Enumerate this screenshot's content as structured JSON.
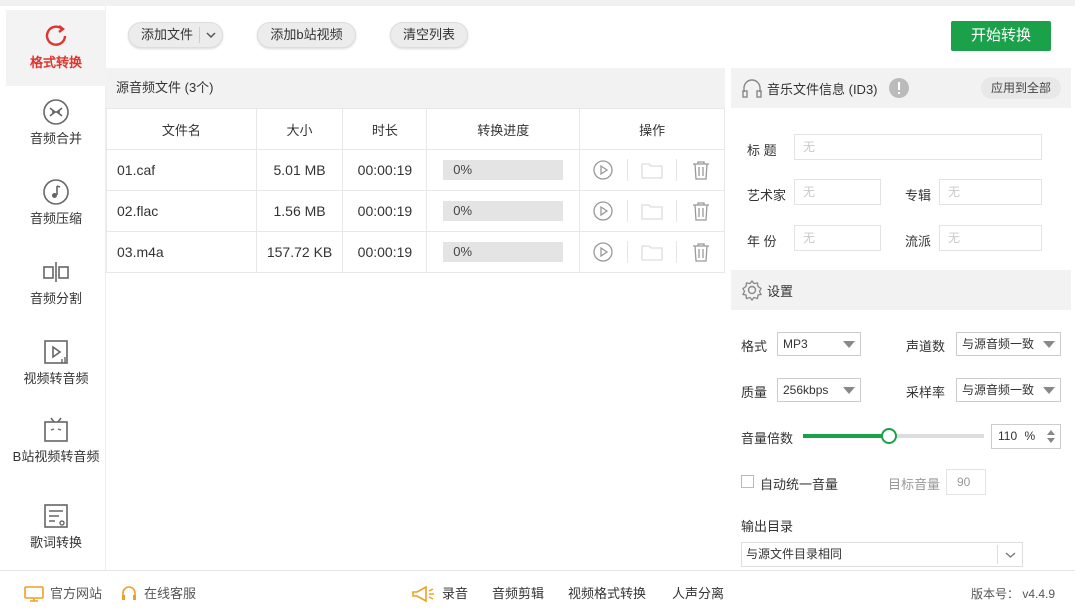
{
  "sidebar": {
    "items": [
      {
        "label": "格式转换",
        "icon": "refresh-icon"
      },
      {
        "label": "音频合并",
        "icon": "merge-icon"
      },
      {
        "label": "音频压缩",
        "icon": "music-note-icon"
      },
      {
        "label": "音频分割",
        "icon": "split-icon"
      },
      {
        "label": "视频转音频",
        "icon": "video-audio-icon"
      },
      {
        "label": "B站视频转音频",
        "icon": "bilibili-tv-icon"
      },
      {
        "label": "歌词转换",
        "icon": "lyrics-icon"
      }
    ]
  },
  "toolbar": {
    "add_file": "添加文件",
    "add_bilibili": "添加b站视频",
    "clear_list": "清空列表",
    "start": "开始转换"
  },
  "files": {
    "header": "源音频文件 (3个)",
    "columns": [
      "文件名",
      "大小",
      "时长",
      "转换进度",
      "操作"
    ],
    "rows": [
      {
        "name": "01.caf",
        "size": "5.01 MB",
        "duration": "00:00:19",
        "progress": "0%"
      },
      {
        "name": "02.flac",
        "size": "1.56 MB",
        "duration": "00:00:19",
        "progress": "0%"
      },
      {
        "name": "03.m4a",
        "size": "157.72 KB",
        "duration": "00:00:19",
        "progress": "0%"
      }
    ]
  },
  "id3": {
    "title": "音乐文件信息 (ID3)",
    "apply_all": "应用到全部",
    "fields": {
      "title_label": "标 题",
      "artist_label": "艺术家",
      "album_label": "专辑",
      "year_label": "年 份",
      "genre_label": "流派",
      "empty": "无"
    }
  },
  "settings": {
    "title": "设置",
    "format_label": "格式",
    "format_value": "MP3",
    "channels_label": "声道数",
    "channels_value": "与源音频一致",
    "quality_label": "质量",
    "quality_value": "256kbps",
    "samplerate_label": "采样率",
    "samplerate_value": "与源音频一致",
    "volume_label": "音量倍数",
    "volume_value": 110,
    "volume_min": 0,
    "volume_max": 200,
    "volume_display": "110",
    "volume_unit": "%",
    "auto_normalize": "自动统一音量",
    "target_label": "目标音量",
    "target_value": "90",
    "output_label": "输出目录",
    "output_value": "与源文件目录相同"
  },
  "footer": {
    "website": "官方网站",
    "service": "在线客服",
    "record": "录音",
    "audio_edit": "音频剪辑",
    "video_convert": "视频格式转换",
    "vocal_split": "人声分离",
    "version": "版本号： v4.4.9"
  },
  "colors": {
    "accent_red": "#e0342f",
    "start_green": "#1aa14a",
    "slider_green": "#1aa14a"
  }
}
